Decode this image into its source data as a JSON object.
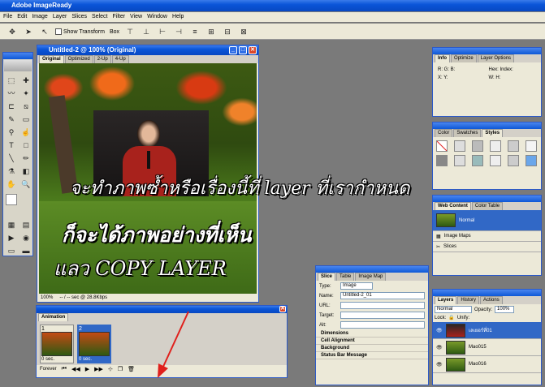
{
  "app": {
    "title": "Adobe ImageReady"
  },
  "menu": [
    "File",
    "Edit",
    "Image",
    "Layer",
    "Slices",
    "Select",
    "Filter",
    "View",
    "Window",
    "Help"
  ],
  "options": {
    "show_transform": "Show Transform",
    "box": "Box"
  },
  "doc": {
    "title": "Untitled-2 @ 100% (Original)",
    "tabs": [
      "Original",
      "Optimized",
      "2-Up",
      "4-Up"
    ],
    "zoom": "100%",
    "status": "-- / -- sec @ 28.8Kbps"
  },
  "overlay": {
    "line1": "จะทำภาพซ้ำหรือเรื่องนี้ที่ layer ที่เรากำหนด",
    "line2": "ก็จะได้ภาพอย่างที่เห็น",
    "line3": "แลว COPY  LAYER"
  },
  "info": {
    "tabs": [
      "Info",
      "Optimize",
      "Layer Options"
    ]
  },
  "swatches": {
    "tabs": [
      "Color",
      "Swatches",
      "Styles"
    ]
  },
  "web": {
    "tabs": [
      "Web Content",
      "Color Table"
    ],
    "normal": "Normal",
    "image_maps": "Image Maps",
    "slices": "Slices"
  },
  "slice": {
    "tabs": [
      "Slice",
      "Table",
      "Image Map"
    ],
    "type_label": "Type:",
    "type_value": "Image",
    "name_label": "Name:",
    "name_value": "Untitled-2_01",
    "url_label": "URL:",
    "target_label": "Target:",
    "alt_label": "Alt:",
    "sections": [
      "Dimensions",
      "Cell Alignment",
      "Background",
      "Status Bar Message"
    ]
  },
  "animation": {
    "title": "Animation",
    "frames": [
      {
        "num": "1",
        "delay": "0 sec."
      },
      {
        "num": "2",
        "delay": "0 sec."
      }
    ],
    "loop": "Forever"
  },
  "layers": {
    "tabs": [
      "Layers",
      "History",
      "Actions"
    ],
    "blend": "Normal",
    "opacity_label": "Opacity:",
    "opacity": "100%",
    "lock": "Lock:",
    "unify": "Unify:",
    "items": [
      "เลเยอร์ที่01",
      "Mao015",
      "Mao016"
    ]
  },
  "colors": {
    "title_blue": "#0a55d8",
    "panel_bg": "#ece9d8",
    "workspace": "#7a7a7a",
    "arrow": "#e0201c"
  }
}
